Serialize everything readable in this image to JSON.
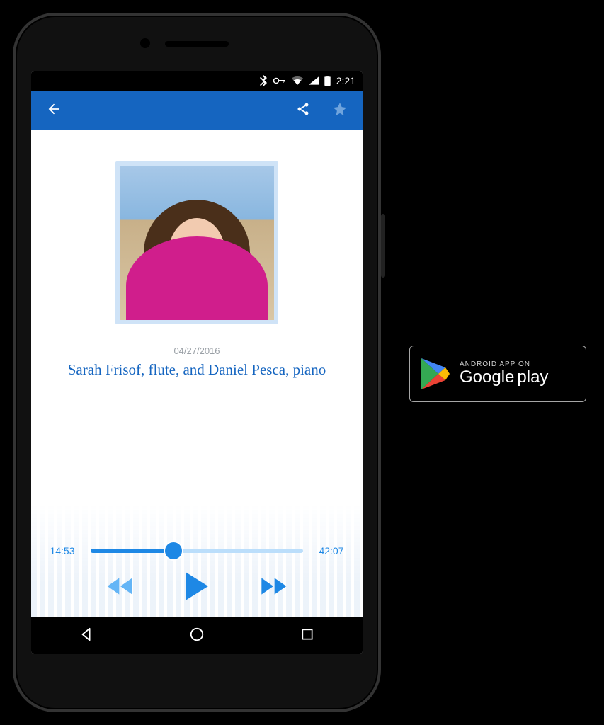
{
  "statusbar": {
    "time": "2:21",
    "icons": [
      "bluetooth",
      "key",
      "wifi",
      "signal",
      "battery"
    ]
  },
  "appbar": {
    "back_icon": "arrow-left",
    "share_icon": "share",
    "favorite_icon": "star"
  },
  "content": {
    "date": "04/27/2016",
    "title": "Sarah Frisof, flute, and Daniel Pesca, piano"
  },
  "player": {
    "elapsed": "14:53",
    "total": "42:07",
    "progress_percent": 39,
    "controls": {
      "rewind": "rewind",
      "play": "play",
      "forward": "forward"
    }
  },
  "navbar": {
    "back": "back",
    "home": "home",
    "recents": "recents"
  },
  "badge": {
    "top": "ANDROID APP ON",
    "brand": "Google",
    "suffix": "play"
  },
  "colors": {
    "primary": "#1565C0",
    "accent": "#1e88e5",
    "track_bg": "#bbdefb"
  }
}
